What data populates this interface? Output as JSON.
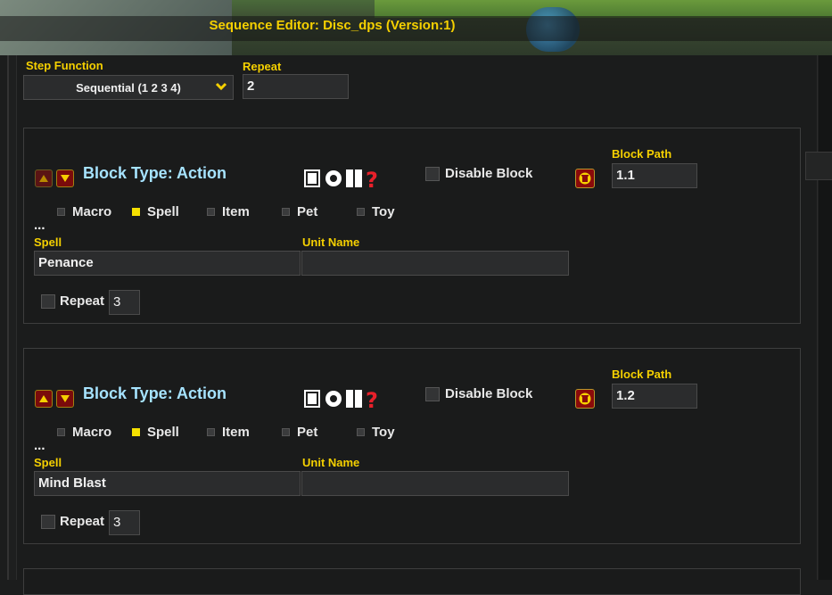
{
  "window": {
    "title": "Sequence Editor: Disc_dps (Version:1)"
  },
  "top": {
    "step_function_label": "Step Function",
    "step_function_value": "Sequential (1 2 3 4)",
    "repeat_label": "Repeat",
    "repeat_value": "2"
  },
  "blocks": [
    {
      "block_type": "Block Type: Action",
      "disable_label": "Disable Block",
      "block_path_label": "Block Path",
      "block_path": "1.1",
      "types": [
        "Macro",
        "Spell",
        "Item",
        "Pet",
        "Toy"
      ],
      "selected_type": "Spell",
      "ellipsis": "...",
      "spell_label": "Spell",
      "spell_value": "Penance",
      "unit_label": "Unit Name",
      "unit_value": "",
      "repeat_label": "Repeat",
      "repeat_value": "3"
    },
    {
      "block_type": "Block Type: Action",
      "disable_label": "Disable Block",
      "block_path_label": "Block Path",
      "block_path": "1.2",
      "types": [
        "Macro",
        "Spell",
        "Item",
        "Pet",
        "Toy"
      ],
      "selected_type": "Spell",
      "ellipsis": "...",
      "spell_label": "Spell",
      "spell_value": "Mind Blast",
      "unit_label": "Unit Name",
      "unit_value": "",
      "repeat_label": "Repeat",
      "repeat_value": "3"
    }
  ],
  "colors": {
    "title": "#f5d000",
    "label": "#f5d000",
    "block_type": "#a6e3ff",
    "selected_radio": "#f5e000"
  },
  "icons": [
    "move-up-icon",
    "move-down-icon",
    "square-icon",
    "circle-icon",
    "pause-icon",
    "question-icon",
    "trash-icon",
    "chevron-down-icon"
  ]
}
